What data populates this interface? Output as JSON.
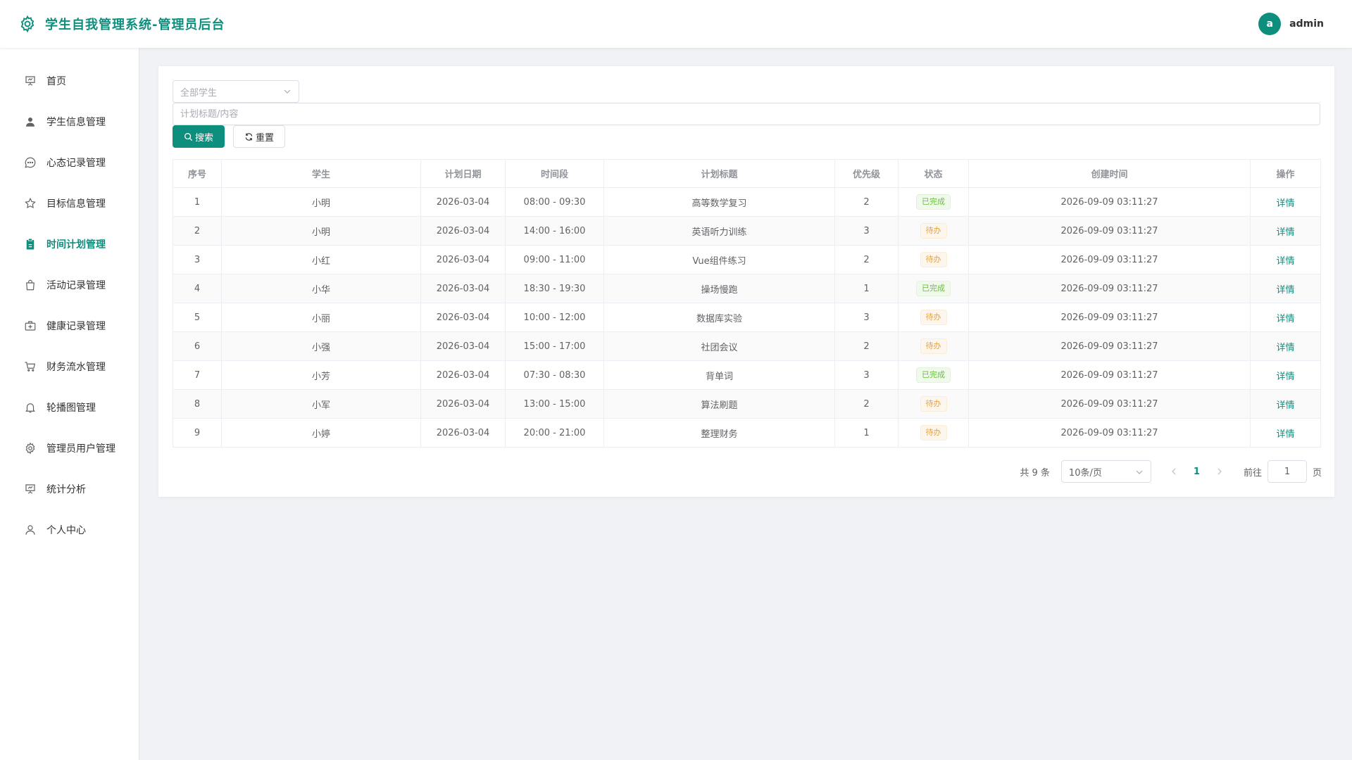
{
  "header": {
    "title": "学生自我管理系统-管理员后台",
    "avatar_letter": "a",
    "username": "admin"
  },
  "sidebar": {
    "items": [
      {
        "label": "首页",
        "icon": "presentation-chart-icon",
        "active": false
      },
      {
        "label": "学生信息管理",
        "icon": "user-icon",
        "active": false
      },
      {
        "label": "心态记录管理",
        "icon": "chat-dots-icon",
        "active": false
      },
      {
        "label": "目标信息管理",
        "icon": "star-icon",
        "active": false
      },
      {
        "label": "时间计划管理",
        "icon": "clipboard-icon",
        "active": true
      },
      {
        "label": "活动记录管理",
        "icon": "shopping-bag-icon",
        "active": false
      },
      {
        "label": "健康记录管理",
        "icon": "first-aid-kit-icon",
        "active": false
      },
      {
        "label": "财务流水管理",
        "icon": "shopping-cart-icon",
        "active": false
      },
      {
        "label": "轮播图管理",
        "icon": "bell-icon",
        "active": false
      },
      {
        "label": "管理员用户管理",
        "icon": "gear-icon",
        "active": false
      },
      {
        "label": "统计分析",
        "icon": "presentation-chart-icon",
        "active": false
      },
      {
        "label": "个人中心",
        "icon": "user-outline-icon",
        "active": false
      }
    ]
  },
  "filters": {
    "student_select": "全部学生",
    "keyword_placeholder": "计划标题/内容",
    "keyword_value": "",
    "search_label": "搜索",
    "reset_label": "重置"
  },
  "table": {
    "headers": [
      "序号",
      "学生",
      "计划日期",
      "时间段",
      "计划标题",
      "优先级",
      "状态",
      "创建时间",
      "操作"
    ],
    "rows": [
      {
        "no": "1",
        "student": "小明",
        "date": "2026-03-04",
        "time": "08:00 - 09:30",
        "title": "高等数学复习",
        "priority": "2",
        "status": "已完成",
        "status_type": "success",
        "created": "2026-09-09 03:11:27",
        "action": "详情"
      },
      {
        "no": "2",
        "student": "小明",
        "date": "2026-03-04",
        "time": "14:00 - 16:00",
        "title": "英语听力训练",
        "priority": "3",
        "status": "待办",
        "status_type": "warning",
        "created": "2026-09-09 03:11:27",
        "action": "详情"
      },
      {
        "no": "3",
        "student": "小红",
        "date": "2026-03-04",
        "time": "09:00 - 11:00",
        "title": "Vue组件练习",
        "priority": "2",
        "status": "待办",
        "status_type": "warning",
        "created": "2026-09-09 03:11:27",
        "action": "详情"
      },
      {
        "no": "4",
        "student": "小华",
        "date": "2026-03-04",
        "time": "18:30 - 19:30",
        "title": "操场慢跑",
        "priority": "1",
        "status": "已完成",
        "status_type": "success",
        "created": "2026-09-09 03:11:27",
        "action": "详情"
      },
      {
        "no": "5",
        "student": "小丽",
        "date": "2026-03-04",
        "time": "10:00 - 12:00",
        "title": "数据库实验",
        "priority": "3",
        "status": "待办",
        "status_type": "warning",
        "created": "2026-09-09 03:11:27",
        "action": "详情"
      },
      {
        "no": "6",
        "student": "小强",
        "date": "2026-03-04",
        "time": "15:00 - 17:00",
        "title": "社团会议",
        "priority": "2",
        "status": "待办",
        "status_type": "warning",
        "created": "2026-09-09 03:11:27",
        "action": "详情"
      },
      {
        "no": "7",
        "student": "小芳",
        "date": "2026-03-04",
        "time": "07:30 - 08:30",
        "title": "背单词",
        "priority": "3",
        "status": "已完成",
        "status_type": "success",
        "created": "2026-09-09 03:11:27",
        "action": "详情"
      },
      {
        "no": "8",
        "student": "小军",
        "date": "2026-03-04",
        "time": "13:00 - 15:00",
        "title": "算法刷题",
        "priority": "2",
        "status": "待办",
        "status_type": "warning",
        "created": "2026-09-09 03:11:27",
        "action": "详情"
      },
      {
        "no": "9",
        "student": "小婷",
        "date": "2026-03-04",
        "time": "20:00 - 21:00",
        "title": "整理财务",
        "priority": "1",
        "status": "待办",
        "status_type": "warning",
        "created": "2026-09-09 03:11:27",
        "action": "详情"
      }
    ]
  },
  "pagination": {
    "total_text": "共 9 条",
    "page_size": "10条/页",
    "current_page": "1",
    "goto_prefix": "前往",
    "goto_value": "1",
    "goto_suffix": "页"
  },
  "colors": {
    "primary": "#0e8f7e",
    "success": "#67c23a",
    "warning": "#e6a23c"
  }
}
